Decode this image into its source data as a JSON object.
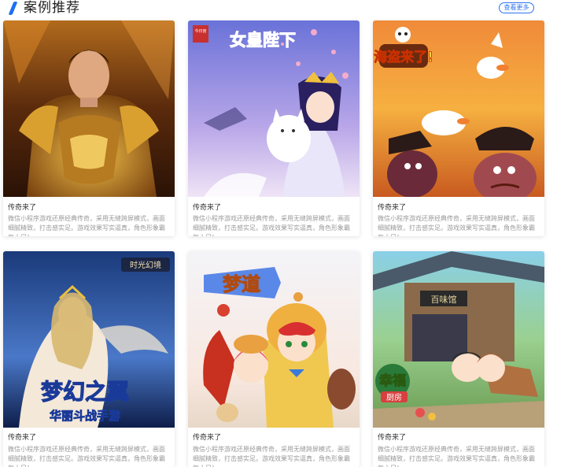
{
  "header": {
    "title": "案例推荐",
    "more_label": "查看更多"
  },
  "cases": [
    {
      "name": "传奇来了",
      "desc": "微信小程序游戏还原经典传奇，采用无缝跨屏模式，画面细腻精致，打击感实足。游戏效果写实逼真，角色形象霸气十足！",
      "image": "armored-warrior-portrait"
    },
    {
      "name": "传奇来了",
      "desc": "微信小程序游戏还原经典传奇，采用无缝跨屏模式，画面细腻精致，打击感实足。游戏效果写实逼真，角色形象霸气十足！",
      "image": "empress-with-white-fox",
      "image_text": [
        "今日宫",
        "女皇陛下"
      ]
    },
    {
      "name": "传奇来了",
      "desc": "微信小程序游戏还原经典传奇，采用无缝跨屏模式，画面细腻精致，打击感实足。游戏效果写实逼真，角色形象霸气十足！",
      "image": "pirate-ducks",
      "image_text": [
        "海盗来了!"
      ]
    },
    {
      "name": "传奇来了",
      "desc": "微信小程序游戏还原经典传奇，采用无缝跨屏模式，画面细腻精致，打击感实足。游戏效果写实逼真，角色形象霸气十足！",
      "image": "winged-elf-heroine",
      "image_text": [
        "时光幻境",
        "梦幻之翼",
        "华丽斗战手游"
      ]
    },
    {
      "name": "传奇来了",
      "desc": "微信小程序游戏还原经典传奇，采用无缝跨屏模式，画面细腻精致，打击感实足。游戏效果写实逼真，角色形象霸气十足！",
      "image": "tiger-hood-kids",
      "image_text": [
        "梦道"
      ]
    },
    {
      "name": "传奇来了",
      "desc": "微信小程序游戏还原经典传奇，采用无缝跨屏模式，画面细腻精致，打击感实足。游戏效果写实逼真，角色形象霸气十足！",
      "image": "village-restaurant",
      "image_text": [
        "百味馆",
        "幸福",
        "厨房"
      ]
    }
  ],
  "colors": {
    "accent": "#1e6ff2"
  }
}
